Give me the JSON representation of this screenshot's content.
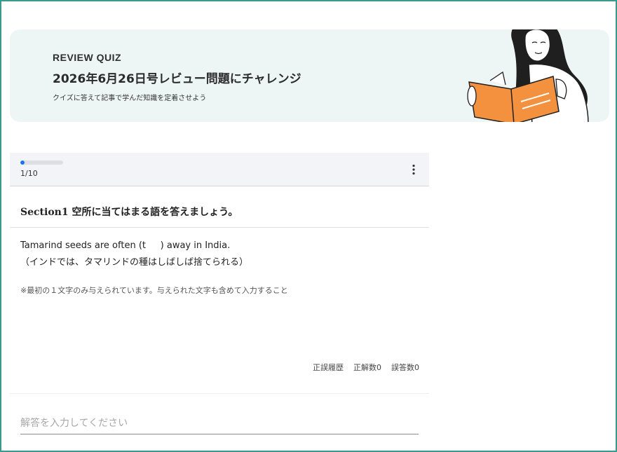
{
  "banner": {
    "kicker": "REVIEW QUIZ",
    "title": "2026年6月26日号レビュー問題にチャレンジ",
    "subtitle": "クイズに答えて記事で学んだ知識を定着させよう"
  },
  "progress": {
    "current": 1,
    "total": 10,
    "text": "1/10",
    "fraction": 0.1,
    "color": "#1a73e8"
  },
  "menu": {
    "icon": "more-vertical-icon"
  },
  "section": {
    "title": "Section1 空所に当てはまる語を答えましょう。"
  },
  "question": {
    "english": "Tamarind seeds are often (t     ) away in India.",
    "japanese": "（インドでは、タマリンドの種はしばしば捨てられる）",
    "note": "※最初の１文字のみ与えられています。与えられた文字も含めて入力すること"
  },
  "stats": {
    "history_label": "正誤履歴",
    "correct_label": "正解数0",
    "wrong_label": "誤答数0"
  },
  "answer": {
    "placeholder": "解答を入力してください"
  },
  "colors": {
    "frame": "#3a9a8e",
    "banner_bg": "#eef6f5",
    "book": "#f4913f"
  }
}
